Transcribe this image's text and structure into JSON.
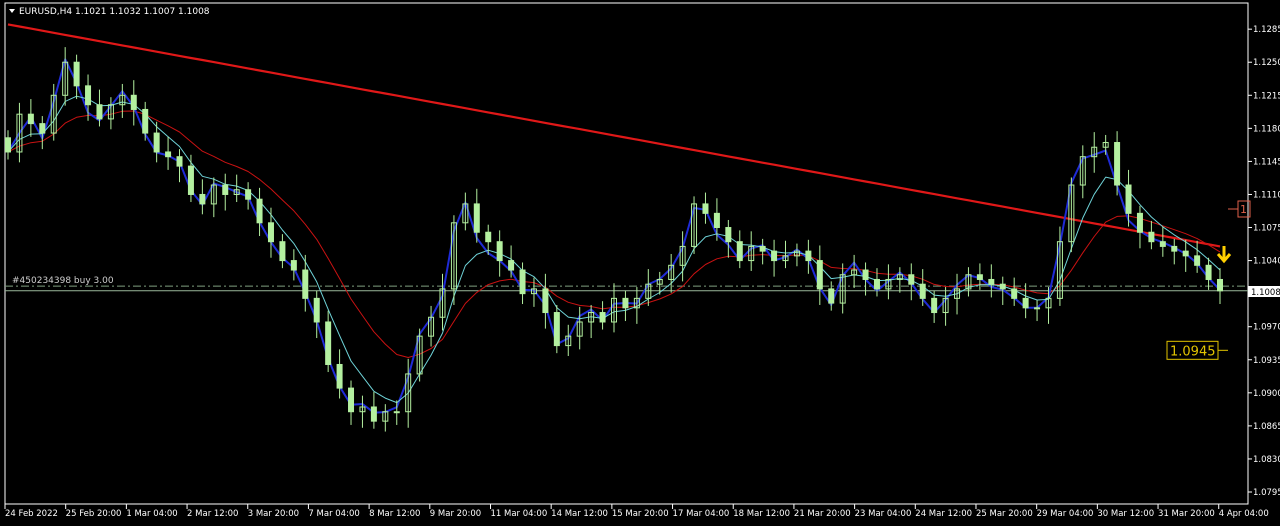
{
  "header": {
    "symbol_text": "EURUSD,H4  1.1021 1.1032 1.1007 1.1008",
    "dropdown_icon": "triangle-down-icon"
  },
  "order_line": {
    "label": "#450234398 buy 3.00"
  },
  "price_tag": {
    "current_price": "1.1008",
    "alert_price": "1.0945",
    "alert_price_value": 1.0945,
    "right_marker_text": "1"
  },
  "colors": {
    "background": "#000000",
    "candle": "#b4f0a0",
    "ma_fast": "#6fd3d8",
    "ma_slow": "#c91212",
    "ma_long": "#e01818",
    "envelope": "#1f2bd6",
    "axis": "#ffffff",
    "arrow": "#ffd000",
    "alert_box": "#e2c400"
  },
  "chart_data": {
    "type": "line",
    "symbol": "EURUSD",
    "timeframe": "H4",
    "ylim": [
      1.0795,
      1.13
    ],
    "y_ticks": [
      "1.1285",
      "1.1250",
      "1.1215",
      "1.1180",
      "1.1145",
      "1.1110",
      "1.1075",
      "1.1040",
      "1.1008",
      "1.0970",
      "1.0935",
      "1.0900",
      "1.0865",
      "1.0830",
      "1.0795"
    ],
    "x_ticks": [
      "24 Feb 2022",
      "25 Feb 20:00",
      "1 Mar 04:00",
      "2 Mar 12:00",
      "3 Mar 20:00",
      "7 Mar 04:00",
      "8 Mar 12:00",
      "9 Mar 20:00",
      "11 Mar 04:00",
      "14 Mar 12:00",
      "15 Mar 20:00",
      "17 Mar 04:00",
      "18 Mar 12:00",
      "21 Mar 20:00",
      "23 Mar 04:00",
      "24 Mar 12:00",
      "25 Mar 20:00",
      "29 Mar 04:00",
      "30 Mar 12:00",
      "31 Mar 20:00",
      "4 Apr 04:00"
    ],
    "order_price": 1.1013,
    "current_price": 1.1008,
    "close": [
      1.1155,
      1.1195,
      1.1185,
      1.1175,
      1.1215,
      1.125,
      1.1225,
      1.1205,
      1.119,
      1.1205,
      1.1215,
      1.12,
      1.1175,
      1.1155,
      1.115,
      1.114,
      1.111,
      1.11,
      1.112,
      1.111,
      1.1115,
      1.1105,
      1.108,
      1.106,
      1.104,
      1.103,
      1.1,
      1.0975,
      1.093,
      1.0905,
      1.088,
      1.0885,
      1.087,
      1.088,
      1.088,
      1.092,
      1.096,
      1.098,
      1.101,
      1.108,
      1.11,
      1.107,
      1.106,
      1.104,
      1.103,
      1.1005,
      1.101,
      1.0985,
      1.095,
      1.096,
      1.0975,
      1.0985,
      1.0975,
      1.1,
      1.099,
      1.1,
      1.1015,
      1.102,
      1.1035,
      1.1055,
      1.11,
      1.109,
      1.1075,
      1.106,
      1.104,
      1.1055,
      1.105,
      1.104,
      1.1045,
      1.105,
      1.104,
      1.101,
      1.0995,
      1.1025,
      1.103,
      1.102,
      1.101,
      1.102,
      1.1025,
      1.1015,
      1.1,
      1.0985,
      1.1,
      1.101,
      1.1025,
      1.102,
      1.1015,
      1.101,
      1.1,
      1.099,
      1.099,
      1.1,
      1.106,
      1.112,
      1.115,
      1.116,
      1.1165,
      1.112,
      1.109,
      1.107,
      1.106,
      1.1055,
      1.105,
      1.1045,
      1.1035,
      1.102,
      1.1008
    ]
  }
}
